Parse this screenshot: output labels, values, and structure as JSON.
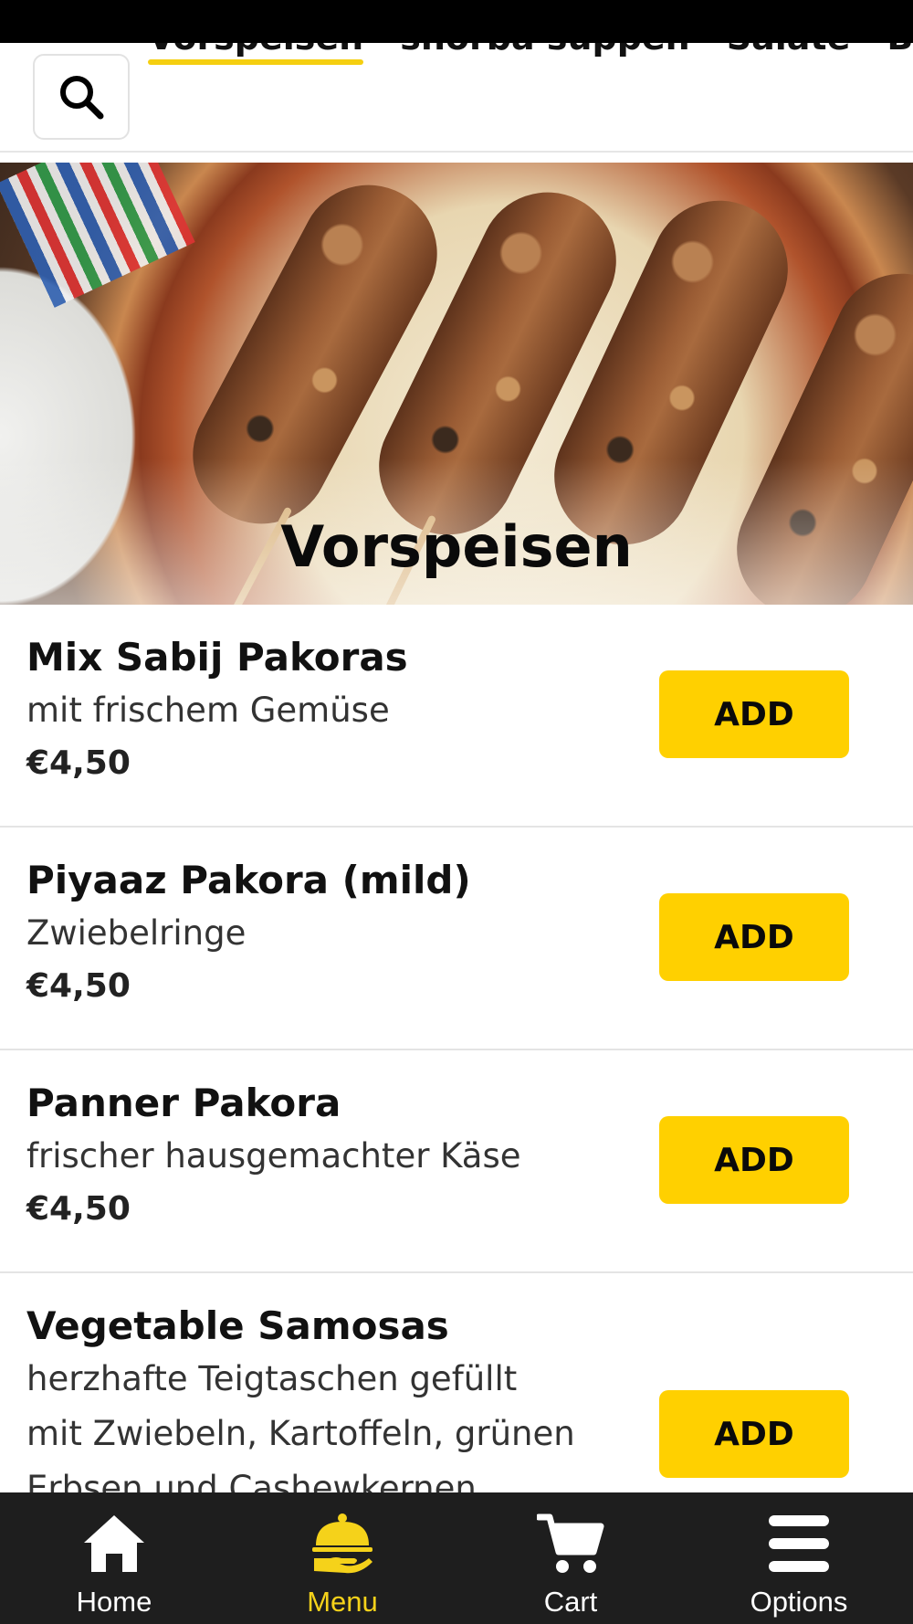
{
  "top_bar": {
    "categories": [
      "Vorspeisen",
      "shorba suppen",
      "Salate",
      "Beil"
    ],
    "active_category": "Vorspeisen"
  },
  "hero": {
    "title": "Vorspeisen"
  },
  "menu": {
    "items": [
      {
        "name": "Mix Sabij Pakoras",
        "description": "mit frischem Gemüse",
        "price": "€4,50",
        "button": "ADD"
      },
      {
        "name": "Piyaaz Pakora (mild)",
        "description": "Zwiebelringe",
        "price": "€4,50",
        "button": "ADD"
      },
      {
        "name": "Panner Pakora",
        "description": "frischer hausgemachter Käse",
        "price": "€4,50",
        "button": "ADD"
      },
      {
        "name": "Vegetable Samosas",
        "description_lines": [
          "herzhafte Teigtaschen gefüllt",
          "mit Zwiebeln, Kartoffeln, grünen",
          "Erbsen und Cashewkernen"
        ],
        "button": "ADD"
      }
    ]
  },
  "bottom_nav": {
    "items": [
      {
        "label": "Home",
        "icon": "home-icon"
      },
      {
        "label": "Menu",
        "icon": "cloche-icon",
        "active": true
      },
      {
        "label": "Cart",
        "icon": "cart-icon"
      },
      {
        "label": "Options",
        "icon": "hamburger-icon"
      }
    ]
  },
  "colors": {
    "accent": "#ffd000",
    "nav_background": "#1e1e1e",
    "nav_active": "#f5d21a",
    "status_bar": "#000000"
  }
}
